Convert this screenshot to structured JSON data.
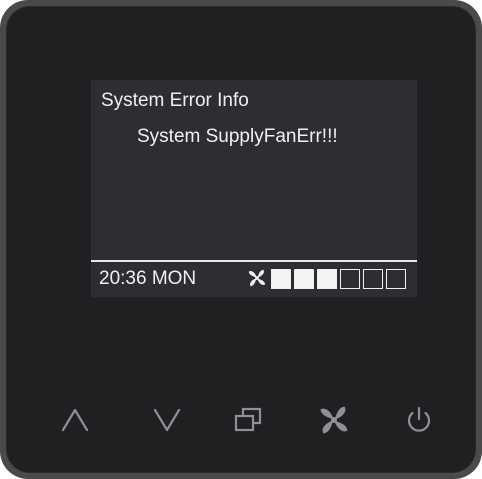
{
  "display": {
    "title": "System Error Info",
    "message": "System SupplyFanErr!!!",
    "status": {
      "time_day": "20:36 MON",
      "fan_icon": "fan-icon",
      "fan_speed": {
        "level": 3,
        "max": 6
      }
    }
  },
  "buttons": [
    {
      "name": "up-button",
      "icon": "chevron-up-icon"
    },
    {
      "name": "down-button",
      "icon": "chevron-down-icon"
    },
    {
      "name": "mode-button",
      "icon": "mode-windows-icon"
    },
    {
      "name": "fan-button",
      "icon": "fan-icon"
    },
    {
      "name": "power-button",
      "icon": "power-icon"
    }
  ],
  "colors": {
    "bezel": "#4a4a4d",
    "panel": "#1f2022",
    "screen": "#2d2e31",
    "text": "#f0f0f0",
    "icons": "#8f9094"
  }
}
